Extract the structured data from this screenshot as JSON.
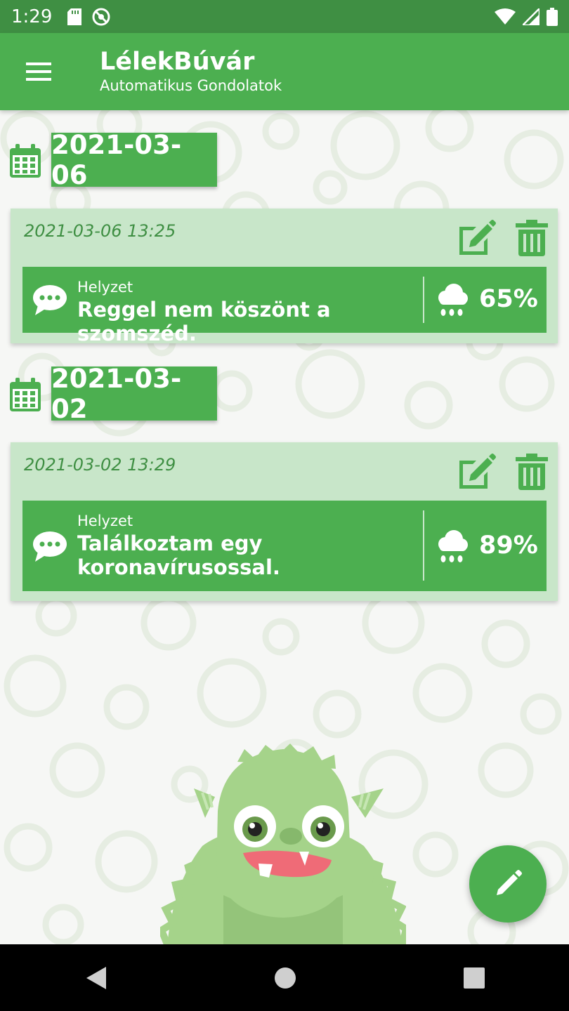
{
  "status_bar": {
    "time": "1:29",
    "icons_left": [
      "sd-card-icon",
      "no-sync-icon"
    ],
    "icons_right": [
      "wifi-icon",
      "signal-icon",
      "battery-icon"
    ]
  },
  "app_bar": {
    "menu_icon": "hamburger-menu-icon",
    "title": "LélekBúvár",
    "subtitle": "Automatikus Gondolatok"
  },
  "groups": [
    {
      "date": "2021-03-06",
      "entries": [
        {
          "timestamp": "2021-03-06 13:25",
          "situation_label": "Helyzet",
          "situation_text": "Reggel nem köszönt a szomszéd.",
          "intensity": "65%"
        }
      ]
    },
    {
      "date": "2021-03-02",
      "entries": [
        {
          "timestamp": "2021-03-02 13:29",
          "situation_label": "Helyzet",
          "situation_text": "Találkoztam egy koronavírusossal.",
          "intensity": "89%"
        }
      ]
    }
  ],
  "fab": {
    "icon": "pencil-icon"
  },
  "nav_bar": {
    "icons": [
      "back-icon",
      "home-icon",
      "recents-icon"
    ]
  },
  "colors": {
    "primary": "#4caf50",
    "primary_dark": "#3f8f43",
    "card_bg": "#c8e6c9",
    "monster": "#a5d38a"
  }
}
